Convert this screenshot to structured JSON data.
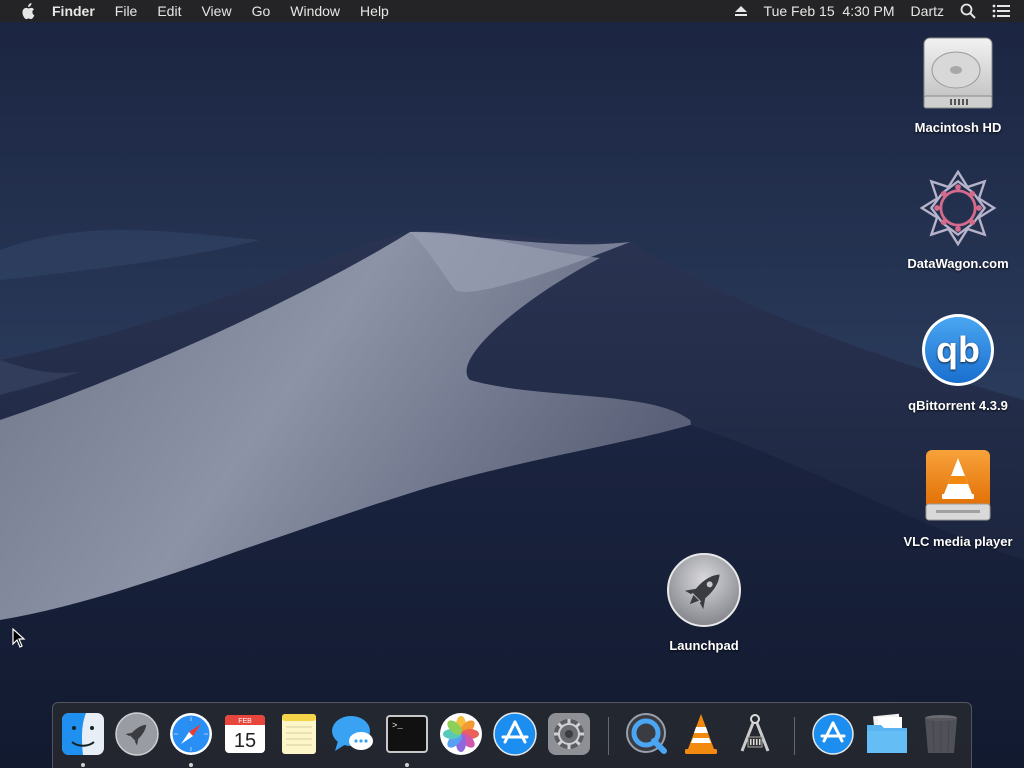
{
  "menubar": {
    "apple_icon": "apple-icon",
    "app_name": "Finder",
    "menus": [
      "File",
      "Edit",
      "View",
      "Go",
      "Window",
      "Help"
    ],
    "datetime": "Tue Feb 15  4:30 PM",
    "user": "Dartz",
    "status_icons": [
      "eject-icon",
      "search-icon",
      "menu-list-icon"
    ]
  },
  "desktop": {
    "icons": [
      {
        "label": "Macintosh HD",
        "icon": "hard-drive-icon"
      },
      {
        "label": "DataWagon.com",
        "icon": "datawagon-icon"
      },
      {
        "label": "qBittorrent 4.3.9",
        "icon": "qbittorrent-icon"
      },
      {
        "label": "VLC media player",
        "icon": "vlc-disk-icon"
      },
      {
        "label": "Launchpad",
        "icon": "launchpad-icon"
      }
    ],
    "qb_text": "qb"
  },
  "dock": {
    "calendar": {
      "month": "FEB",
      "day": "15"
    },
    "terminal_prompt": ">_",
    "items": [
      {
        "name": "Finder",
        "icon": "finder-icon",
        "running": true
      },
      {
        "name": "Launchpad",
        "icon": "launchpad-icon",
        "running": false
      },
      {
        "name": "Safari",
        "icon": "safari-icon",
        "running": true
      },
      {
        "name": "Calendar",
        "icon": "calendar-icon",
        "running": false
      },
      {
        "name": "Notes",
        "icon": "notes-icon",
        "running": false
      },
      {
        "name": "Messages",
        "icon": "messages-icon",
        "running": false
      },
      {
        "name": "Terminal",
        "icon": "terminal-icon",
        "running": true
      },
      {
        "name": "Photos",
        "icon": "photos-icon",
        "running": false
      },
      {
        "name": "App Store",
        "icon": "app-store-icon",
        "running": false
      },
      {
        "name": "System Preferences",
        "icon": "system-preferences-icon",
        "running": false
      },
      {
        "name": "QuickTime Player",
        "icon": "quicktime-icon",
        "running": false
      },
      {
        "name": "VLC",
        "icon": "vlc-icon",
        "running": false
      },
      {
        "name": "Xcode Instruments",
        "icon": "instruments-icon",
        "running": false
      },
      {
        "name": "Applications",
        "icon": "applications-folder-icon",
        "running": false
      },
      {
        "name": "Documents",
        "icon": "documents-folder-icon",
        "running": false
      },
      {
        "name": "Trash",
        "icon": "trash-icon",
        "running": false
      }
    ]
  },
  "colors": {
    "menubar_bg": "#242426",
    "sky": "#1f2c47",
    "dune_light": "#8d93a6",
    "dock_bg": "#2a2c32",
    "accent_blue": "#1f8ff0",
    "vlc_orange": "#f28a10"
  }
}
